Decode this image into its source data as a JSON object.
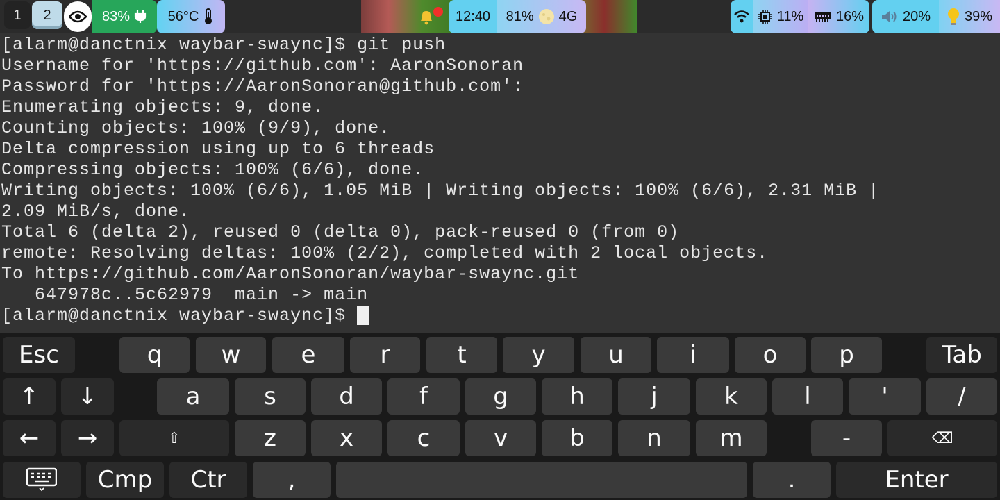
{
  "topbar": {
    "workspaces": [
      "1",
      "2"
    ],
    "battery": "83%",
    "temperature": "56°C",
    "clock": "12:40",
    "status_battery": "81%",
    "network": "4G",
    "cpu": "11%",
    "memory": "16%",
    "volume": "20%",
    "brightness": "39%",
    "icons": [
      "eye-icon",
      "plug-icon",
      "thermometer-icon",
      "bell-icon",
      "moon-icon",
      "wifi-icon",
      "cpu-icon",
      "memory-icon",
      "speaker-icon",
      "lightbulb-icon"
    ],
    "colors": {
      "battery_bg": "#27a65a",
      "pill_cyan": "#63d0f0",
      "pill_lavender": "#c6b3f2",
      "notification_dot": "#f0302a"
    }
  },
  "terminal": {
    "lines": [
      "[alarm@danctnix waybar-swaync]$ git push",
      "Username for 'https://github.com': AaronSonoran",
      "Password for 'https://AaronSonoran@github.com':",
      "Enumerating objects: 9, done.",
      "Counting objects: 100% (9/9), done.",
      "Delta compression using up to 6 threads",
      "Compressing objects: 100% (6/6), done.",
      "Writing objects: 100% (6/6), 1.05 MiB | Writing objects: 100% (6/6), 2.31 MiB |",
      "2.09 MiB/s, done.",
      "Total 6 (delta 2), reused 0 (delta 0), pack-reused 0 (from 0)",
      "remote: Resolving deltas: 100% (2/2), completed with 2 local objects.",
      "To https://github.com/AaronSonoran/waybar-swaync.git",
      "   647978c..5c62979  main -> main"
    ],
    "prompt": "[alarm@danctnix waybar-swaync]$ "
  },
  "keyboard": {
    "row1": {
      "left": "Esc",
      "keys": [
        "q",
        "w",
        "e",
        "r",
        "t",
        "y",
        "u",
        "i",
        "o",
        "p"
      ],
      "right": "Tab"
    },
    "row2": {
      "up": "↑",
      "down": "↓",
      "keys": [
        "a",
        "s",
        "d",
        "f",
        "g",
        "h",
        "j",
        "k",
        "l",
        "'",
        "/"
      ]
    },
    "row3": {
      "left": "←",
      "right": "→",
      "shift": "⇧",
      "keys": [
        "z",
        "x",
        "c",
        "v",
        "b",
        "n",
        "m",
        "-"
      ],
      "backspace": "⌫"
    },
    "row4": {
      "keyboard_icon": "keyboard-icon",
      "cmp": "Cmp",
      "ctr": "Ctr",
      "comma": ",",
      "space": "",
      "period": ".",
      "enter": "Enter"
    }
  }
}
